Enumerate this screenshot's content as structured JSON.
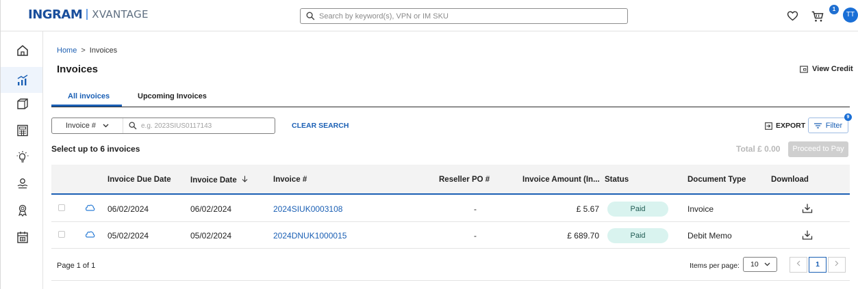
{
  "header": {
    "logo_main": "INGRAM",
    "logo_sub": "XVANTAGE",
    "search_placeholder": "Search by keyword(s), VPN or IM SKU",
    "cart_count": "1",
    "avatar_initials": "TT"
  },
  "breadcrumb": {
    "home": "Home",
    "separator": ">",
    "current": "Invoices"
  },
  "page": {
    "title": "Invoices",
    "view_credit": "View Credit"
  },
  "tabs": [
    {
      "label": "All invoices",
      "active": true
    },
    {
      "label": "Upcoming Invoices",
      "active": false
    }
  ],
  "filter": {
    "field_label": "Invoice #",
    "input_placeholder": "e.g. 2023SIUS0117143",
    "clear_label": "CLEAR SEARCH",
    "export_label": "EXPORT",
    "filter_label": "Filter",
    "filter_count": "9"
  },
  "selection": {
    "note": "Select up to 6 invoices",
    "total": "Total £ 0.00",
    "pay_button": "Proceed to Pay"
  },
  "table": {
    "headers": {
      "due_date": "Invoice Due Date",
      "invoice_date": "Invoice Date",
      "invoice_no": "Invoice #",
      "reseller_po": "Reseller PO #",
      "amount": "Invoice Amount (In...",
      "status": "Status",
      "doc_type": "Document Type",
      "download": "Download"
    },
    "rows": [
      {
        "due_date": "06/02/2024",
        "invoice_date": "06/02/2024",
        "invoice_no": "2024SIUK0003108",
        "reseller_po": "-",
        "amount": "£ 5.67",
        "status": "Paid",
        "doc_type": "Invoice"
      },
      {
        "due_date": "05/02/2024",
        "invoice_date": "05/02/2024",
        "invoice_no": "2024DNUK1000015",
        "reseller_po": "-",
        "amount": "£ 689.70",
        "status": "Paid",
        "doc_type": "Debit Memo"
      }
    ]
  },
  "pagination": {
    "page_info": "Page 1 of 1",
    "items_per_page_label": "Items per page:",
    "items_per_page": "10",
    "current_page": "1"
  },
  "colors": {
    "accent": "#1a5fb4",
    "status_paid_bg": "#d9f3ef"
  }
}
